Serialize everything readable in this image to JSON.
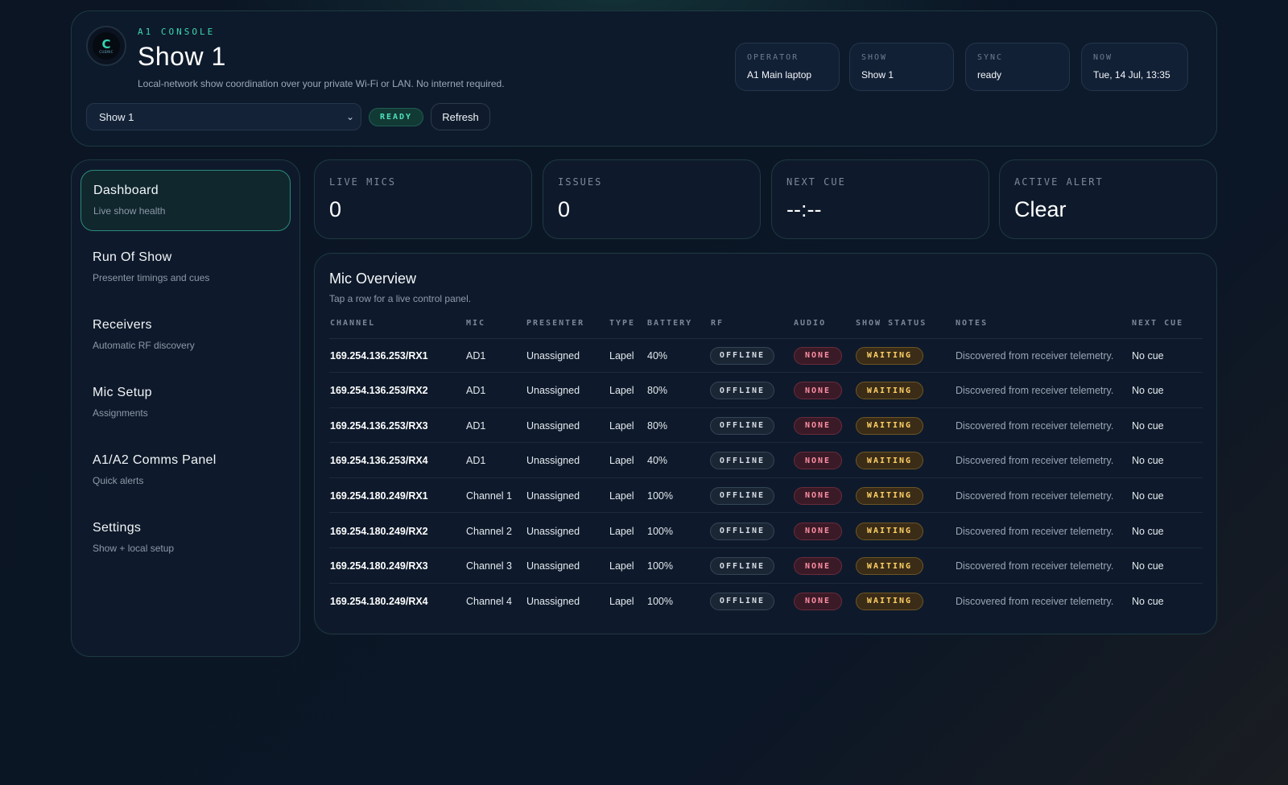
{
  "header": {
    "eyebrow": "A1 CONSOLE",
    "title": "Show 1",
    "subtitle": "Local-network show coordination over your private Wi-Fi or LAN. No internet required.",
    "show_select_value": "Show 1",
    "status_badge": "READY",
    "refresh_label": "Refresh",
    "logo_glyph": "C",
    "logo_text": "CUEMIC",
    "meta": [
      {
        "label": "OPERATOR",
        "value": "A1 Main laptop"
      },
      {
        "label": "SHOW",
        "value": "Show 1"
      },
      {
        "label": "SYNC",
        "value": "ready"
      },
      {
        "label": "NOW",
        "value": "Tue, 14 Jul, 13:35"
      }
    ]
  },
  "sidebar": {
    "items": [
      {
        "title": "Dashboard",
        "subtitle": "Live show health",
        "active": true
      },
      {
        "title": "Run Of Show",
        "subtitle": "Presenter timings and cues"
      },
      {
        "title": "Receivers",
        "subtitle": "Automatic RF discovery"
      },
      {
        "title": "Mic Setup",
        "subtitle": "Assignments"
      },
      {
        "title": "A1/A2 Comms Panel",
        "subtitle": "Quick alerts"
      },
      {
        "title": "Settings",
        "subtitle": "Show + local setup"
      }
    ]
  },
  "stats": [
    {
      "label": "LIVE MICS",
      "value": "0"
    },
    {
      "label": "ISSUES",
      "value": "0"
    },
    {
      "label": "NEXT CUE",
      "value": "--:--"
    },
    {
      "label": "ACTIVE ALERT",
      "value": "Clear"
    }
  ],
  "mic_overview": {
    "title": "Mic Overview",
    "subtitle": "Tap a row for a live control panel.",
    "columns": [
      "CHANNEL",
      "MIC",
      "PRESENTER",
      "TYPE",
      "BATTERY",
      "RF",
      "AUDIO",
      "SHOW STATUS",
      "NOTES",
      "NEXT CUE"
    ],
    "rows": [
      {
        "channel": "169.254.136.253/RX1",
        "mic": "AD1",
        "presenter": "Unassigned",
        "type": "Lapel",
        "battery": "40%",
        "rf": "OFFLINE",
        "audio": "NONE",
        "status": "WAITING",
        "notes": "Discovered from receiver telemetry.",
        "next_cue": "No cue"
      },
      {
        "channel": "169.254.136.253/RX2",
        "mic": "AD1",
        "presenter": "Unassigned",
        "type": "Lapel",
        "battery": "80%",
        "rf": "OFFLINE",
        "audio": "NONE",
        "status": "WAITING",
        "notes": "Discovered from receiver telemetry.",
        "next_cue": "No cue"
      },
      {
        "channel": "169.254.136.253/RX3",
        "mic": "AD1",
        "presenter": "Unassigned",
        "type": "Lapel",
        "battery": "80%",
        "rf": "OFFLINE",
        "audio": "NONE",
        "status": "WAITING",
        "notes": "Discovered from receiver telemetry.",
        "next_cue": "No cue"
      },
      {
        "channel": "169.254.136.253/RX4",
        "mic": "AD1",
        "presenter": "Unassigned",
        "type": "Lapel",
        "battery": "40%",
        "rf": "OFFLINE",
        "audio": "NONE",
        "status": "WAITING",
        "notes": "Discovered from receiver telemetry.",
        "next_cue": "No cue"
      },
      {
        "channel": "169.254.180.249/RX1",
        "mic": "Channel 1",
        "presenter": "Unassigned",
        "type": "Lapel",
        "battery": "100%",
        "rf": "OFFLINE",
        "audio": "NONE",
        "status": "WAITING",
        "notes": "Discovered from receiver telemetry.",
        "next_cue": "No cue"
      },
      {
        "channel": "169.254.180.249/RX2",
        "mic": "Channel 2",
        "presenter": "Unassigned",
        "type": "Lapel",
        "battery": "100%",
        "rf": "OFFLINE",
        "audio": "NONE",
        "status": "WAITING",
        "notes": "Discovered from receiver telemetry.",
        "next_cue": "No cue"
      },
      {
        "channel": "169.254.180.249/RX3",
        "mic": "Channel 3",
        "presenter": "Unassigned",
        "type": "Lapel",
        "battery": "100%",
        "rf": "OFFLINE",
        "audio": "NONE",
        "status": "WAITING",
        "notes": "Discovered from receiver telemetry.",
        "next_cue": "No cue"
      },
      {
        "channel": "169.254.180.249/RX4",
        "mic": "Channel 4",
        "presenter": "Unassigned",
        "type": "Lapel",
        "battery": "100%",
        "rf": "OFFLINE",
        "audio": "NONE",
        "status": "WAITING",
        "notes": "Discovered from receiver telemetry.",
        "next_cue": "No cue"
      }
    ]
  },
  "colors": {
    "accent": "#3dd6b0",
    "background": "#0b1524",
    "panel": "#0e1a2b",
    "offline": "#d6dde5",
    "none": "#ff8fa5",
    "waiting": "#ffd166"
  }
}
